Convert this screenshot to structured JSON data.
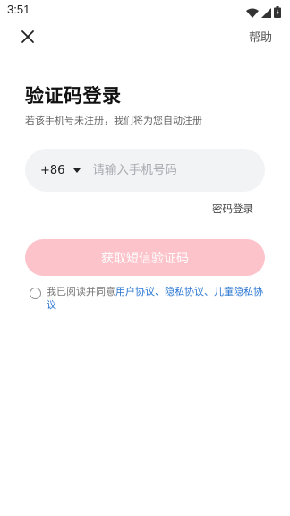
{
  "status": {
    "time": "3:51"
  },
  "topbar": {
    "close_icon": "close-icon",
    "help_label": "帮助"
  },
  "header": {
    "title": "验证码登录",
    "subtitle": "若该手机号未注册，我们将为您自动注册"
  },
  "phone": {
    "country_code": "+86",
    "placeholder": "请输入手机号码",
    "value": ""
  },
  "password_login_label": "密码登录",
  "sms_button_label": "获取短信验证码",
  "agreement": {
    "prefix": "我已阅读并同意",
    "user_agreement": "用户协议",
    "sep1": "、",
    "privacy_agreement": "隐私协议",
    "sep2": "、",
    "child_privacy": "儿童隐私协议"
  },
  "colors": {
    "button_bg": "#fcc3ca",
    "link": "#2a76d2",
    "input_bg": "#f1f3f5"
  }
}
